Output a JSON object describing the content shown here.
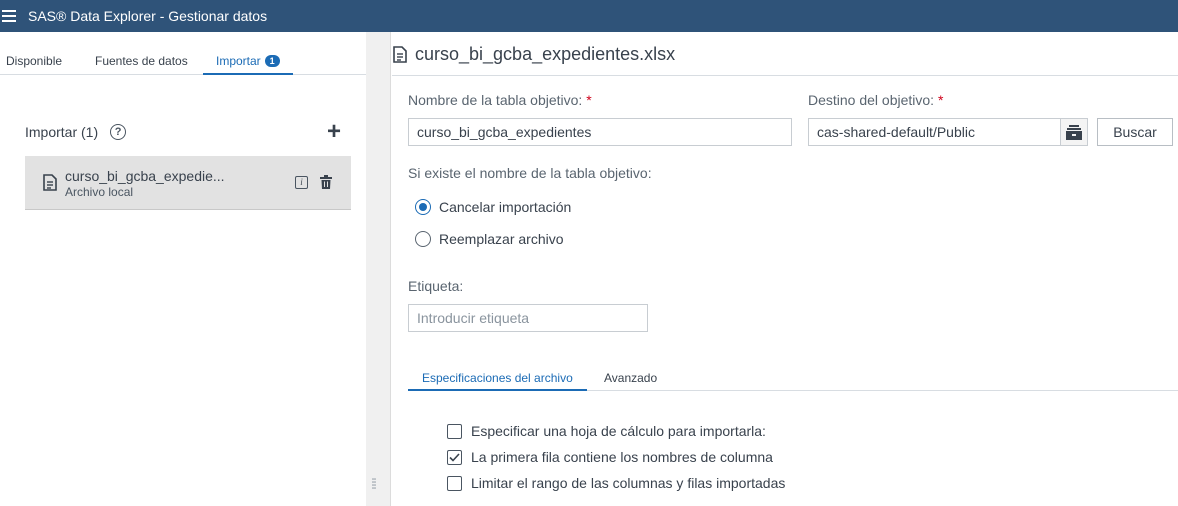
{
  "app": {
    "title": "SAS® Data Explorer - Gestionar datos"
  },
  "tabs": [
    {
      "label": "Disponible"
    },
    {
      "label": "Fuentes de datos"
    },
    {
      "label": "Importar",
      "badge": "1"
    }
  ],
  "import_panel": {
    "header": "Importar (1)",
    "help_glyph": "?",
    "add_glyph": "+",
    "item": {
      "name": "curso_bi_gcba_expedie...",
      "sub": "Archivo local",
      "info_glyph": "i"
    }
  },
  "detail": {
    "title": "curso_bi_gcba_expedientes.xlsx",
    "target_table_label": "Nombre de la tabla objetivo:",
    "target_table_value": "curso_bi_gcba_expedientes",
    "target_dest_label": "Destino del objetivo:",
    "target_dest_value": "cas-shared-default/Public",
    "required_mark": "*",
    "browse_button": "Buscar",
    "exists_label": "Si existe el nombre de la tabla objetivo:",
    "radio_cancel": "Cancelar importación",
    "radio_replace": "Reemplazar archivo",
    "tag_label": "Etiqueta:",
    "tag_placeholder": "Introducir etiqueta",
    "subtab_spec": "Especificaciones del archivo",
    "subtab_advanced": "Avanzado",
    "cb_sheet": "Especificar una hoja de cálculo para importarla:",
    "cb_header_row": "La primera fila contiene los nombres de columna",
    "cb_limit": "Limitar el rango de las columnas y filas importadas",
    "check_glyph": "✓"
  },
  "colors": {
    "topbar": "#2f5379",
    "accent": "#1b6bb5",
    "required": "#d0021b"
  }
}
